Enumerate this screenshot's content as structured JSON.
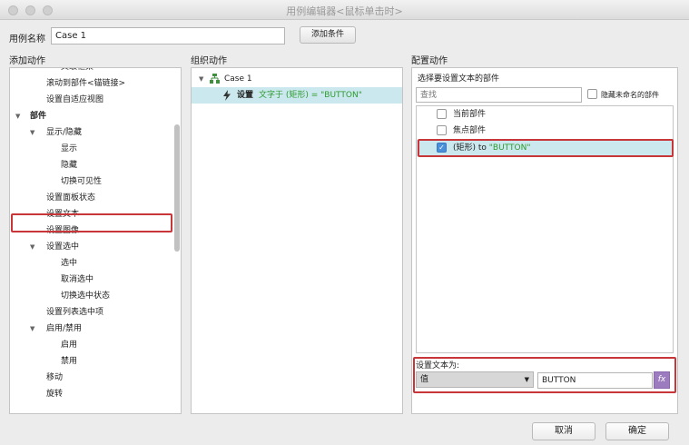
{
  "window": {
    "title": "用例编辑器<鼠标单击时>"
  },
  "case": {
    "label": "用例名称",
    "value": "Case 1",
    "add_condition": "添加条件"
  },
  "left_panel": {
    "heading": "添加动作",
    "items": [
      {
        "label": "父级框架",
        "level": 3
      },
      {
        "label": "滚动到部件<锚链接>",
        "level": 2
      },
      {
        "label": "设置自适应视图",
        "level": 2
      },
      {
        "label": "部件",
        "level": 0,
        "expanded": true
      },
      {
        "label": "显示/隐藏",
        "level": 1,
        "expanded": true
      },
      {
        "label": "显示",
        "level": 3
      },
      {
        "label": "隐藏",
        "level": 3
      },
      {
        "label": "切换可见性",
        "level": 3
      },
      {
        "label": "设置面板状态",
        "level": 2
      },
      {
        "label": "设置文本",
        "level": 2,
        "highlighted": true
      },
      {
        "label": "设置图像",
        "level": 2
      },
      {
        "label": "设置选中",
        "level": 1,
        "expanded": true
      },
      {
        "label": "选中",
        "level": 3
      },
      {
        "label": "取消选中",
        "level": 3
      },
      {
        "label": "切换选中状态",
        "level": 3
      },
      {
        "label": "设置列表选中项",
        "level": 2
      },
      {
        "label": "启用/禁用",
        "level": 1,
        "expanded": true
      },
      {
        "label": "启用",
        "level": 3
      },
      {
        "label": "禁用",
        "level": 3
      },
      {
        "label": "移动",
        "level": 2
      },
      {
        "label": "旋转",
        "level": 2
      }
    ]
  },
  "mid_panel": {
    "heading": "组织动作",
    "case_name": "Case 1",
    "action_verb": "设置",
    "action_text": "文字于 (矩形) = \"BUTTON\""
  },
  "right_panel": {
    "heading": "配置动作",
    "subtitle": "选择要设置文本的部件",
    "search_placeholder": "查找",
    "hide_unnamed": "隐藏未命名的部件",
    "widgets": [
      {
        "label": "当前部件",
        "checked": false
      },
      {
        "label": "焦点部件",
        "checked": false
      },
      {
        "label_prefix": "(矩形) to ",
        "label_value": "\"BUTTON\"",
        "checked": true
      }
    ],
    "set_text_label": "设置文本为:",
    "type_value": "值",
    "text_value": "BUTTON",
    "fx": "fx"
  },
  "footer": {
    "cancel": "取消",
    "ok": "确定"
  },
  "colors": {
    "highlight_red": "#c9363a",
    "selected_row": "#cbe8ef",
    "green_text": "#2e9a2e",
    "fx_purple": "#9c7bbf"
  }
}
